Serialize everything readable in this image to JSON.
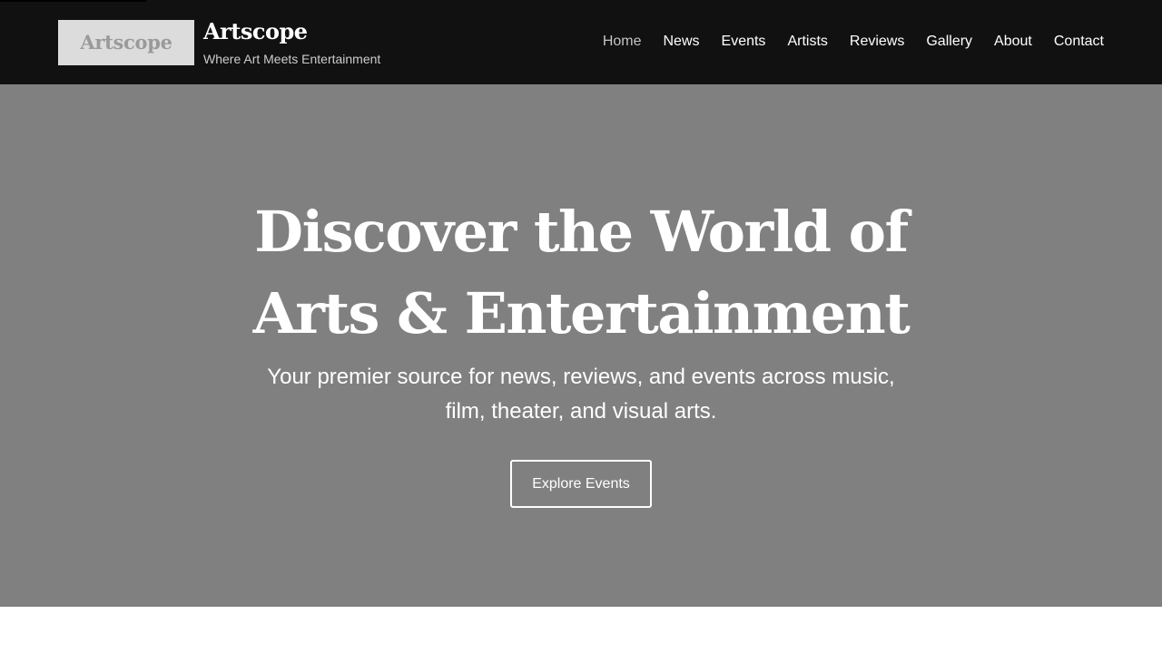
{
  "header": {
    "logo_text": "Artscope",
    "brand_name": "Artscope",
    "tagline": "Where Art Meets Entertainment",
    "background_color": "#111111"
  },
  "nav": {
    "items": [
      {
        "label": "Home",
        "active": true
      },
      {
        "label": "News",
        "active": false
      },
      {
        "label": "Events",
        "active": false
      },
      {
        "label": "Artists",
        "active": false
      },
      {
        "label": "Reviews",
        "active": false
      },
      {
        "label": "Gallery",
        "active": false
      },
      {
        "label": "About",
        "active": false
      },
      {
        "label": "Contact",
        "active": false
      }
    ]
  },
  "hero": {
    "title": "Discover the World of Arts & Entertainment",
    "subtitle": "Your premier source for news, reviews, and events across music, film, theater, and visual arts.",
    "cta_label": "Explore Events",
    "background_color": "#808080"
  }
}
